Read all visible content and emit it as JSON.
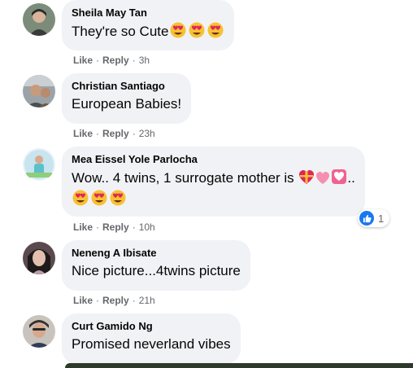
{
  "comments": [
    {
      "author": "Sheila May Tan",
      "text": "They're so Cute",
      "emojis": [
        "heart-eyes",
        "heart-eyes",
        "heart-eyes"
      ],
      "like": "Like",
      "reply": "Reply",
      "time": "3h"
    },
    {
      "author": "Christian Santiago",
      "text": "European Babies!",
      "like": "Like",
      "reply": "Reply",
      "time": "23h"
    },
    {
      "author": "Mea Eissel Yole Parlocha",
      "text": "Wow.. 4 twins, 1 surrogate mother is",
      "trailing": "..",
      "emojis": [
        "gift-heart",
        "pink-heart",
        "heart-square",
        "heart-eyes",
        "heart-eyes",
        "heart-eyes"
      ],
      "like": "Like",
      "reply": "Reply",
      "time": "10h",
      "reaction_count": "1",
      "reaction_icon": "like-icon"
    },
    {
      "author": "Neneng A Ibisate",
      "text": "Nice picture...4twins picture",
      "like": "Like",
      "reply": "Reply",
      "time": "21h"
    },
    {
      "author": "Curt Gamido Ng",
      "text": "Promised neverland vibes"
    }
  ],
  "separator": "·",
  "colors": {
    "bubble": "#f0f2f5",
    "meta": "#65676b",
    "like_blue": "#1877f2",
    "emoji_yellow": "#f7c133",
    "heart_red": "#e0245e",
    "heart_pink": "#f48fb1"
  }
}
